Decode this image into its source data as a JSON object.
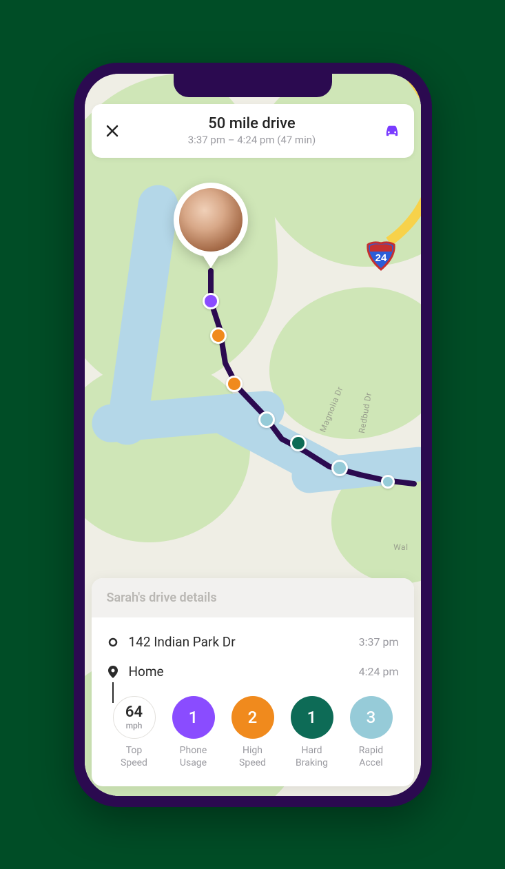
{
  "header": {
    "title": "50 mile drive",
    "subtitle": "3:37 pm – 4:24 pm (47 min)"
  },
  "map": {
    "interstate_number": "24",
    "streets": {
      "magnolia": "Magnolia Dr",
      "redbud": "Redbud Dr",
      "walnut": "Wal"
    }
  },
  "card": {
    "heading": "Sarah's drive details",
    "start": {
      "label": "142 Indian Park Dr",
      "time": "3:37 pm"
    },
    "end": {
      "label": "Home",
      "time": "4:24 pm"
    }
  },
  "stats": {
    "top_speed": {
      "value": "64",
      "unit": "mph",
      "label": "Top\nSpeed"
    },
    "phone_usage": {
      "value": "1",
      "label": "Phone\nUsage"
    },
    "high_speed": {
      "value": "2",
      "label": "High\nSpeed"
    },
    "hard_braking": {
      "value": "1",
      "label": "Hard\nBraking"
    },
    "rapid_accel": {
      "value": "3",
      "label": "Rapid\nAccel"
    }
  },
  "colors": {
    "purple": "#8a4cff",
    "orange": "#f08a1d",
    "teal": "#0d6b56",
    "cyan": "#96cbd8"
  }
}
